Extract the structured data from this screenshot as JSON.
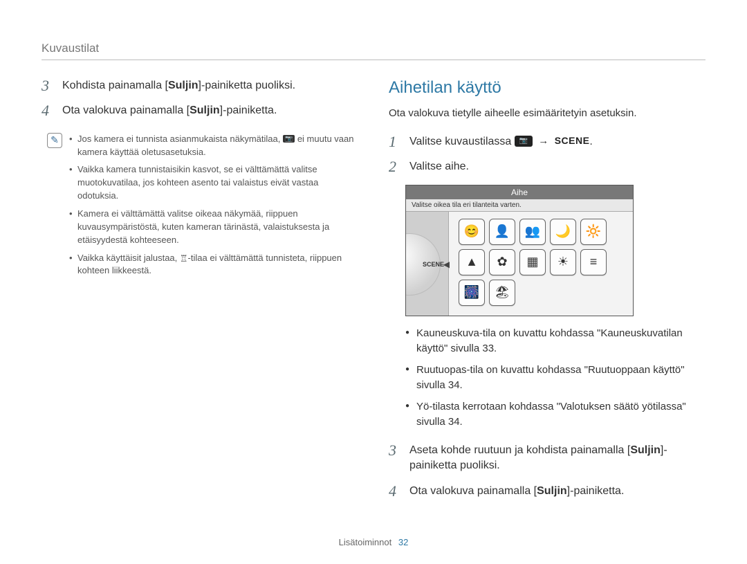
{
  "breadcrumb": "Kuvaustilat",
  "left": {
    "steps": [
      {
        "num": "3",
        "pre": "Kohdista painamalla [",
        "bold": "Suljin",
        "post": "]-painiketta puoliksi."
      },
      {
        "num": "4",
        "pre": "Ota valokuva painamalla [",
        "bold": "Suljin",
        "post": "]-painiketta."
      }
    ],
    "note_items": [
      {
        "pre": "Jos kamera ei tunnista asianmukaista näkymätilaa, ",
        "icon": "SMART",
        "post": " ei muutu vaan kamera käyttää oletusasetuksia."
      },
      {
        "pre": "Vaikka kamera tunnistaisikin kasvot, se ei välttämättä valitse muotokuvatilaa, jos kohteen asento tai valaistus eivät vastaa odotuksia.",
        "icon": "",
        "post": ""
      },
      {
        "pre": "Kamera ei välttämättä valitse oikeaa näkymää, riippuen kuvausympäristöstä, kuten kameran tärinästä, valaistuksesta ja etäisyydestä kohteeseen.",
        "icon": "",
        "post": ""
      },
      {
        "pre": "Vaikka käyttäisit jalustaa, ",
        "icon": "tripod",
        "post": "-tilaa ei välttämättä tunnisteta, riippuen kohteen liikkeestä."
      }
    ]
  },
  "right": {
    "title": "Aihetilan käyttö",
    "intro": "Ota valokuva tietylle aiheelle esimääritetyin asetuksin.",
    "steps_top": [
      {
        "num": "1",
        "text": "Valitse kuvaustilassa ",
        "arrow_after": true
      },
      {
        "num": "2",
        "text": "Valitse aihe."
      }
    ],
    "screenshot": {
      "header": "Aihe",
      "hint": "Valitse oikea tila eri tilanteita varten.",
      "dial_label": "SCENE",
      "grid_icons": [
        "😊",
        "👤",
        "👥",
        "🌙",
        "🔆",
        "▲",
        "✿",
        "▦",
        "☀",
        "≡",
        "🎆",
        "🏖"
      ]
    },
    "sub_bullets": [
      "Kauneuskuva-tila on kuvattu kohdassa \"Kauneuskuvatilan käyttö\" sivulla 33.",
      "Ruutuopas-tila on kuvattu kohdassa \"Ruutuoppaan käyttö\" sivulla 34.",
      "Yö-tilasta kerrotaan kohdassa \"Valotuksen säätö yötilassa\" sivulla 34."
    ],
    "steps_bottom": [
      {
        "num": "3",
        "pre": "Aseta kohde ruutuun ja kohdista painamalla [",
        "bold": "Suljin",
        "post": "]-painiketta puoliksi."
      },
      {
        "num": "4",
        "pre": "Ota valokuva painamalla [",
        "bold": "Suljin",
        "post": "]-painiketta."
      }
    ]
  },
  "footer": {
    "section": "Lisätoiminnot",
    "page": "32"
  },
  "icons": {
    "arrow": "→",
    "scene": "SCENE",
    "tripod": "⌖"
  }
}
